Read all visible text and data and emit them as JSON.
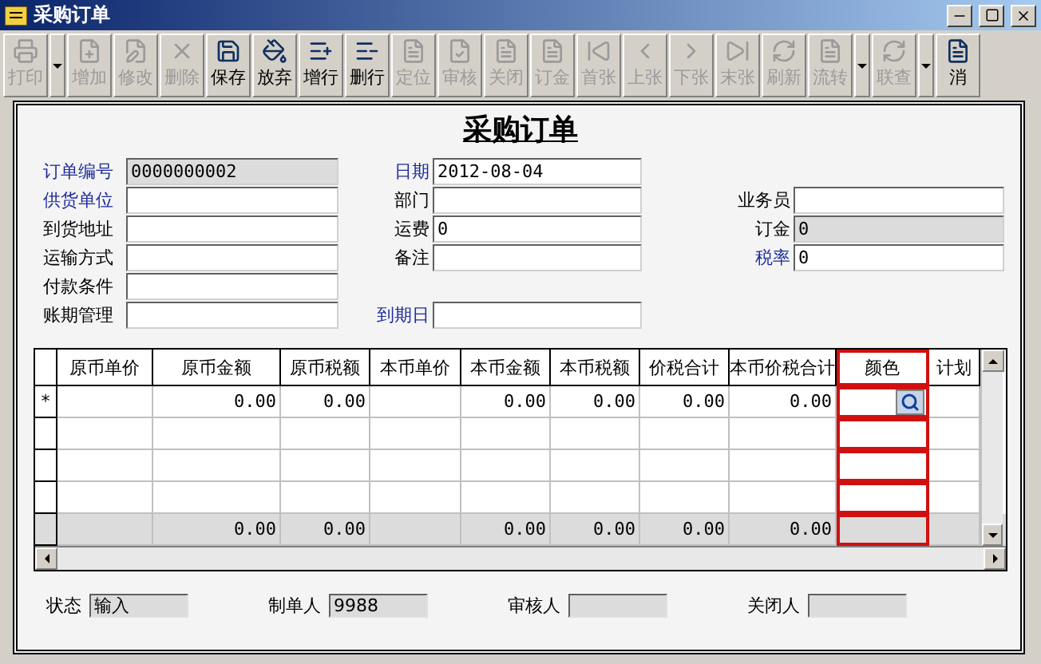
{
  "window": {
    "title": "采购订单"
  },
  "toolbar": [
    {
      "label": "打印",
      "disabled": true,
      "dropdown": true
    },
    {
      "label": "增加",
      "disabled": true,
      "dropdown": false
    },
    {
      "label": "修改",
      "disabled": true,
      "dropdown": false
    },
    {
      "label": "删除",
      "disabled": true,
      "dropdown": false
    },
    {
      "label": "保存",
      "disabled": false,
      "dropdown": false
    },
    {
      "label": "放弃",
      "disabled": false,
      "dropdown": false
    },
    {
      "label": "增行",
      "disabled": false,
      "dropdown": false
    },
    {
      "label": "删行",
      "disabled": false,
      "dropdown": false
    },
    {
      "label": "定位",
      "disabled": true,
      "dropdown": false
    },
    {
      "label": "审核",
      "disabled": true,
      "dropdown": false
    },
    {
      "label": "关闭",
      "disabled": true,
      "dropdown": false
    },
    {
      "label": "订金",
      "disabled": true,
      "dropdown": false
    },
    {
      "label": "首张",
      "disabled": true,
      "dropdown": false
    },
    {
      "label": "上张",
      "disabled": true,
      "dropdown": false
    },
    {
      "label": "下张",
      "disabled": true,
      "dropdown": false
    },
    {
      "label": "末张",
      "disabled": true,
      "dropdown": false
    },
    {
      "label": "刷新",
      "disabled": true,
      "dropdown": false
    },
    {
      "label": "流转",
      "disabled": true,
      "dropdown": true
    },
    {
      "label": "联查",
      "disabled": true,
      "dropdown": true
    },
    {
      "label": "消",
      "disabled": false,
      "dropdown": false
    }
  ],
  "form": {
    "title": "采购订单",
    "rows": [
      {
        "left": {
          "label": "订单编号",
          "required": true,
          "readonly": true,
          "value": "0000000002"
        },
        "middle": {
          "label": "日期",
          "required": true,
          "readonly": false,
          "value": "2012-08-04"
        }
      },
      {
        "left": {
          "label": "供货单位",
          "required": true,
          "readonly": false
        },
        "middle": {
          "label": "部门",
          "required": false,
          "readonly": false
        },
        "right": {
          "label": "业务员",
          "required": false,
          "readonly": false
        }
      },
      {
        "left": {
          "label": "到货地址",
          "required": false,
          "readonly": false
        },
        "middle": {
          "label": "运费",
          "required": false,
          "readonly": false,
          "value": "0"
        },
        "right": {
          "label": "订金",
          "required": false,
          "readonly": true,
          "value": "0"
        }
      },
      {
        "left": {
          "label": "运输方式",
          "required": false,
          "readonly": false
        },
        "middle": {
          "label": "备注",
          "required": false,
          "readonly": false
        },
        "right": {
          "label": "税率",
          "required": true,
          "readonly": false,
          "value": "0"
        }
      },
      {
        "left": {
          "label": "付款条件",
          "required": false,
          "readonly": false
        }
      },
      {
        "left": {
          "label": "账期管理",
          "required": false,
          "readonly": false
        },
        "middle": {
          "label": "到期日",
          "required": true,
          "readonly": false
        }
      }
    ]
  },
  "table": {
    "columns": [
      {
        "label": "原币单价",
        "highlighted": false
      },
      {
        "label": "原币金额",
        "highlighted": false
      },
      {
        "label": "原币税额",
        "highlighted": false
      },
      {
        "label": "本币单价",
        "highlighted": false
      },
      {
        "label": "本币金额",
        "highlighted": false
      },
      {
        "label": "本币税额",
        "highlighted": false
      },
      {
        "label": "价税合计",
        "highlighted": false
      },
      {
        "label": "本币价税合计",
        "highlighted": false
      },
      {
        "label": "颜色",
        "highlighted": true
      },
      {
        "label": "计划",
        "highlighted": false
      }
    ],
    "rows": [
      {
        "marker": "*",
        "cells": [
          {
            "kind": "empty"
          },
          {
            "kind": "text",
            "value": "0.00"
          },
          {
            "kind": "text",
            "value": "0.00"
          },
          {
            "kind": "empty"
          },
          {
            "kind": "text",
            "value": "0.00"
          },
          {
            "kind": "text",
            "value": "0.00"
          },
          {
            "kind": "text",
            "value": "0.00"
          },
          {
            "kind": "text",
            "value": "0.00"
          },
          {
            "kind": "lookup"
          },
          {
            "kind": "empty"
          }
        ]
      },
      {
        "cells": [
          {
            "kind": "empty"
          },
          {
            "kind": "empty"
          },
          {
            "kind": "empty"
          },
          {
            "kind": "empty"
          },
          {
            "kind": "empty"
          },
          {
            "kind": "empty"
          },
          {
            "kind": "empty"
          },
          {
            "kind": "empty"
          },
          {
            "kind": "empty"
          },
          {
            "kind": "empty"
          }
        ]
      },
      {
        "cells": [
          {
            "kind": "empty"
          },
          {
            "kind": "empty"
          },
          {
            "kind": "empty"
          },
          {
            "kind": "empty"
          },
          {
            "kind": "empty"
          },
          {
            "kind": "empty"
          },
          {
            "kind": "empty"
          },
          {
            "kind": "empty"
          },
          {
            "kind": "empty"
          },
          {
            "kind": "empty"
          }
        ]
      },
      {
        "cells": [
          {
            "kind": "empty"
          },
          {
            "kind": "empty"
          },
          {
            "kind": "empty"
          },
          {
            "kind": "empty"
          },
          {
            "kind": "empty"
          },
          {
            "kind": "empty"
          },
          {
            "kind": "empty"
          },
          {
            "kind": "empty"
          },
          {
            "kind": "empty"
          },
          {
            "kind": "empty"
          }
        ]
      }
    ],
    "totals": [
      {
        "kind": "empty"
      },
      {
        "kind": "text",
        "value": "0.00"
      },
      {
        "kind": "text",
        "value": "0.00"
      },
      {
        "kind": "empty"
      },
      {
        "kind": "text",
        "value": "0.00"
      },
      {
        "kind": "text",
        "value": "0.00"
      },
      {
        "kind": "text",
        "value": "0.00"
      },
      {
        "kind": "text",
        "value": "0.00"
      },
      {
        "kind": "empty"
      },
      {
        "kind": "empty"
      }
    ]
  },
  "status_bar": [
    {
      "label": "状态",
      "value": "输入"
    },
    {
      "label": "制单人",
      "value": "9988"
    },
    {
      "label": "审核人"
    },
    {
      "label": "关闭人"
    }
  ]
}
